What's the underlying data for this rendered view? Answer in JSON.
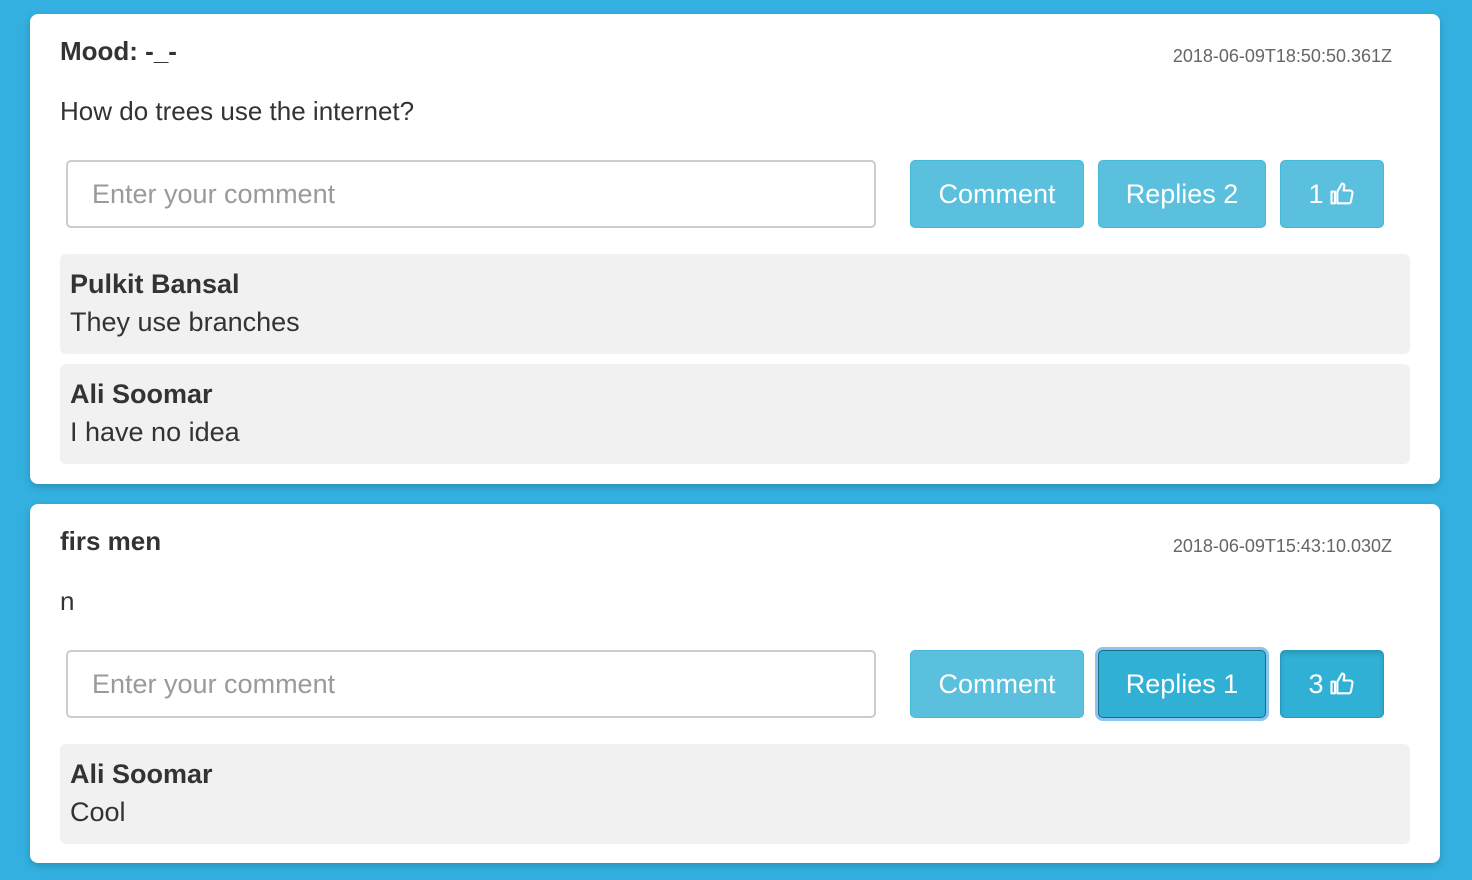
{
  "posts": [
    {
      "title": "Mood: -_-",
      "timestamp": "2018-06-09T18:50:50.361Z",
      "body": "How do trees use the internet?",
      "comment_placeholder": "Enter your comment",
      "comment_button": "Comment",
      "replies_button": "Replies 2",
      "likes": "1",
      "like_icon": "thumbs-up-icon",
      "replies": [
        {
          "author": "Pulkit Bansal",
          "text": "They use branches"
        },
        {
          "author": "Ali Soomar",
          "text": "I have no idea"
        }
      ]
    },
    {
      "title": "firs men",
      "timestamp": "2018-06-09T15:43:10.030Z",
      "body": "n",
      "comment_placeholder": "Enter your comment",
      "comment_button": "Comment",
      "replies_button": "Replies 1",
      "likes": "3",
      "like_icon": "thumbs-up-icon",
      "replies": [
        {
          "author": "Ali Soomar",
          "text": "Cool"
        }
      ]
    }
  ],
  "colors": {
    "background": "#33b0e0",
    "card": "#ffffff",
    "button": "#5bc0de",
    "button_active": "#31b0d5",
    "reply_background": "#f1f1f1"
  }
}
